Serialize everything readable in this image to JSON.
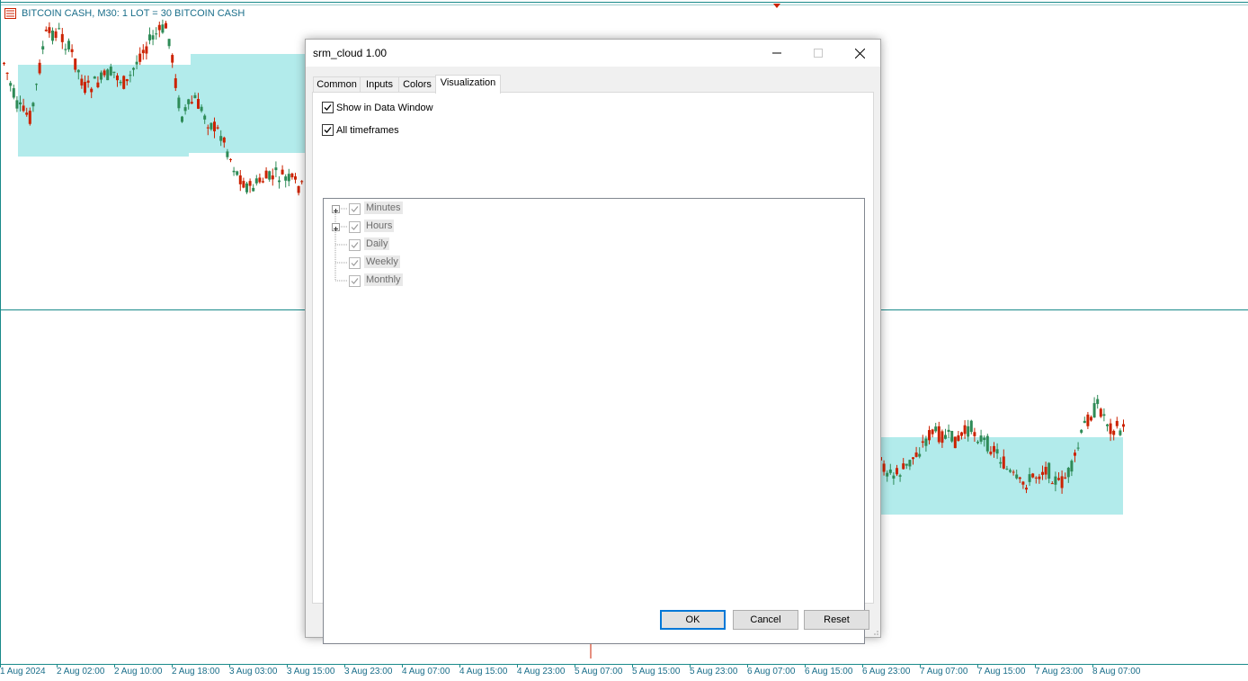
{
  "chart": {
    "title": "BITCOIN CASH, M30:  1 LOT = 30 BITCOIN CASH",
    "x_ticks": [
      "1 Aug 2024",
      "2 Aug 02:00",
      "2 Aug 10:00",
      "2 Aug 18:00",
      "3 Aug 03:00",
      "3 Aug 15:00",
      "3 Aug 23:00",
      "4 Aug 07:00",
      "4 Aug 15:00",
      "4 Aug 23:00",
      "5 Aug 07:00",
      "5 Aug 15:00",
      "5 Aug 23:00",
      "6 Aug 07:00",
      "6 Aug 15:00",
      "6 Aug 23:00",
      "7 Aug 07:00",
      "7 Aug 15:00",
      "7 Aug 23:00",
      "8 Aug 07:00"
    ],
    "colors": {
      "bull": "#2e8b57",
      "bear": "#cc2200",
      "cloud": "#b2ebeb",
      "line": "#1a8a8a"
    }
  },
  "dialog": {
    "title": "srm_cloud 1.00",
    "tabs": [
      {
        "label": "Common"
      },
      {
        "label": "Inputs"
      },
      {
        "label": "Colors"
      },
      {
        "label": "Visualization"
      }
    ],
    "active_tab": "Visualization",
    "show_in_data_window": {
      "label": "Show in Data Window",
      "checked": true
    },
    "all_timeframes": {
      "label": "All timeframes",
      "checked": true
    },
    "timeframes": [
      {
        "label": "Minutes",
        "expandable": true,
        "checked": true
      },
      {
        "label": "Hours",
        "expandable": true,
        "checked": true
      },
      {
        "label": "Daily",
        "expandable": false,
        "checked": true
      },
      {
        "label": "Weekly",
        "expandable": false,
        "checked": true
      },
      {
        "label": "Monthly",
        "expandable": false,
        "checked": true
      }
    ],
    "buttons": {
      "ok": "OK",
      "cancel": "Cancel",
      "reset": "Reset"
    }
  }
}
